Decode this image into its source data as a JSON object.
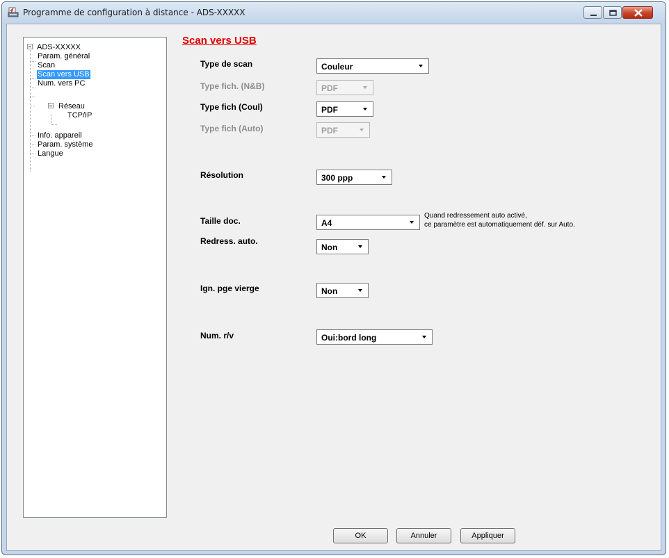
{
  "window": {
    "title": "Programme de configuration à distance - ADS-XXXXX"
  },
  "tree": {
    "root": "ADS-XXXXX",
    "items": [
      "Param. général",
      "Scan",
      "Scan vers USB",
      "Num. vers PC",
      "Réseau",
      "TCP/IP",
      "Info. appareil",
      "Param. système",
      "Langue"
    ],
    "selected": "Scan vers USB"
  },
  "section": {
    "title": "Scan vers USB"
  },
  "fields": {
    "scan_type": {
      "label": "Type de scan",
      "value": "Couleur"
    },
    "file_type_bw": {
      "label": "Type fich. (N&B)",
      "value": "PDF",
      "disabled": true
    },
    "file_type_color": {
      "label": "Type fich (Coul)",
      "value": "PDF"
    },
    "file_type_auto": {
      "label": "Type fich (Auto)",
      "value": "PDF",
      "disabled": true
    },
    "resolution": {
      "label": "Résolution",
      "value": "300 ppp"
    },
    "doc_size": {
      "label": "Taille doc.",
      "value": "A4",
      "hint_line1": "Quand redressement auto activé,",
      "hint_line2": "ce paramètre est automatiquement déf. sur Auto."
    },
    "auto_deskew": {
      "label": "Redress. auto.",
      "value": "Non"
    },
    "skip_blank": {
      "label": "Ign. pge vierge",
      "value": "Non"
    },
    "duplex": {
      "label": "Num. r/v",
      "value": "Oui:bord long"
    }
  },
  "buttons": {
    "ok": "OK",
    "cancel": "Annuler",
    "apply": "Appliquer"
  },
  "icons": {
    "app": "config-printer-icon",
    "minimize": "minimize-icon",
    "maximize": "maximize-icon",
    "close": "close-icon"
  },
  "colors": {
    "section_title": "#e00000",
    "selection": "#3399ff",
    "close_button": "#c8432a"
  }
}
